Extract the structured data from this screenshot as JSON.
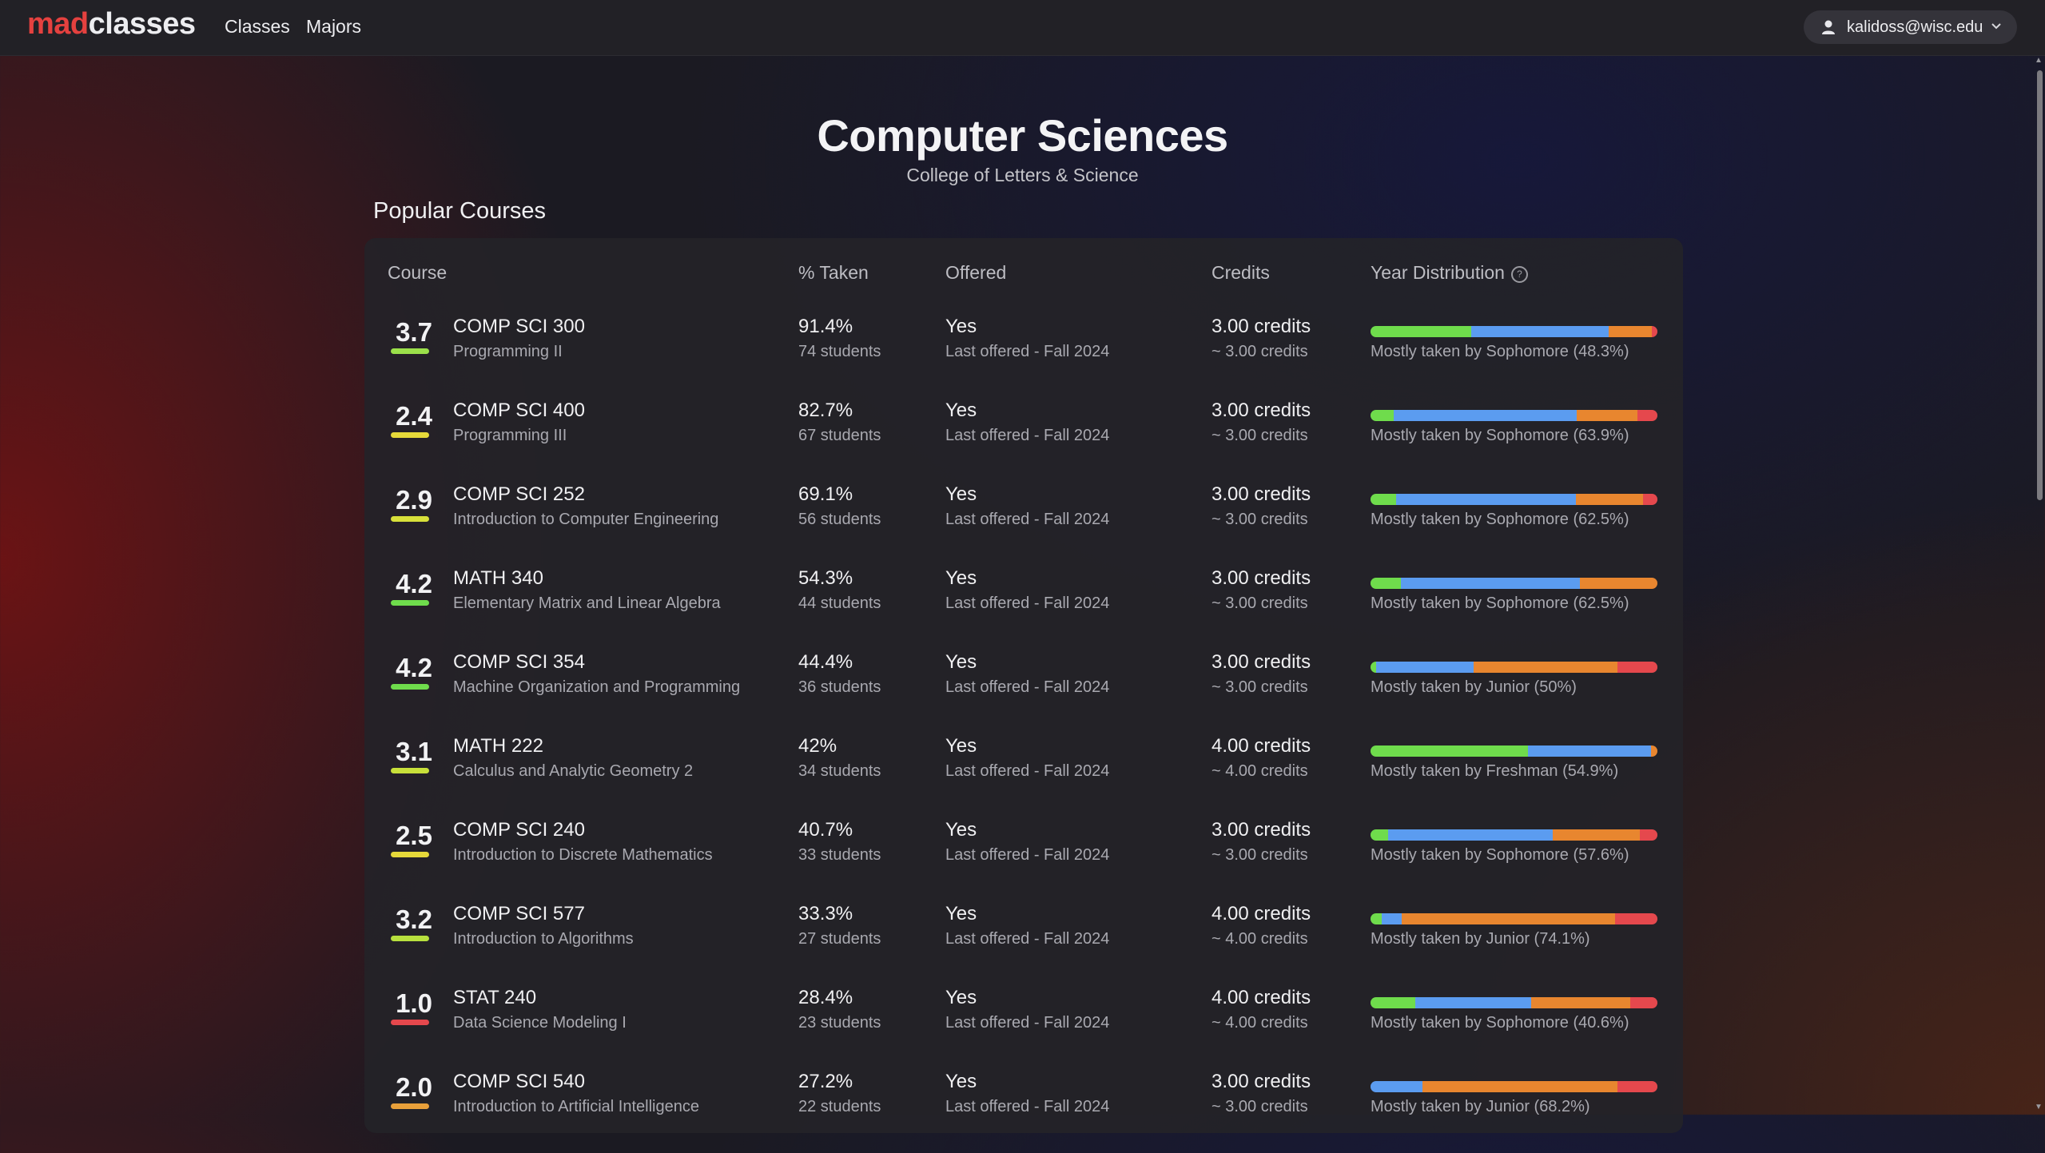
{
  "nav": {
    "logo_part1": "mad",
    "logo_part2": "classes",
    "links": [
      "Classes",
      "Majors"
    ],
    "user_email": "kalidoss@wisc.edu"
  },
  "page": {
    "title": "Computer Sciences",
    "subtitle": "College of Letters & Science",
    "section_title": "Popular Courses"
  },
  "table": {
    "headers": {
      "course": "Course",
      "taken": "% Taken",
      "offered": "Offered",
      "credits": "Credits",
      "distribution": "Year Distribution"
    },
    "colors": {
      "freshman": "#6fdc4c",
      "sophomore": "#5b9cf0",
      "junior": "#e8862f",
      "senior": "#e5484d"
    },
    "rows": [
      {
        "gpa": "3.7",
        "gpa_color": "#9be04a",
        "code": "COMP SCI 300",
        "name": "Programming II",
        "pct": "91.4%",
        "students": "74 students",
        "offered": "Yes",
        "last": "Last offered - Fall 2024",
        "credits": "3.00 credits",
        "credits_approx": "~ 3.00 credits",
        "dist": [
          0.35,
          0.48,
          0.15,
          0.02
        ],
        "mostly": "Mostly taken by Sophomore (48.3%)"
      },
      {
        "gpa": "2.4",
        "gpa_color": "#e6d93a",
        "code": "COMP SCI 400",
        "name": "Programming III",
        "pct": "82.7%",
        "students": "67 students",
        "offered": "Yes",
        "last": "Last offered - Fall 2024",
        "credits": "3.00 credits",
        "credits_approx": "~ 3.00 credits",
        "dist": [
          0.08,
          0.64,
          0.21,
          0.07
        ],
        "mostly": "Mostly taken by Sophomore (63.9%)"
      },
      {
        "gpa": "2.9",
        "gpa_color": "#d8e03a",
        "code": "COMP SCI 252",
        "name": "Introduction to Computer Engineering",
        "pct": "69.1%",
        "students": "56 students",
        "offered": "Yes",
        "last": "Last offered - Fall 2024",
        "credits": "3.00 credits",
        "credits_approx": "~ 3.00 credits",
        "dist": [
          0.09,
          0.625,
          0.235,
          0.05
        ],
        "mostly": "Mostly taken by Sophomore (62.5%)"
      },
      {
        "gpa": "4.2",
        "gpa_color": "#6fdc4c",
        "code": "MATH 340",
        "name": "Elementary Matrix and Linear Algebra",
        "pct": "54.3%",
        "students": "44 students",
        "offered": "Yes",
        "last": "Last offered - Fall 2024",
        "credits": "3.00 credits",
        "credits_approx": "~ 3.00 credits",
        "dist": [
          0.105,
          0.625,
          0.27,
          0.0
        ],
        "mostly": "Mostly taken by Sophomore (62.5%)"
      },
      {
        "gpa": "4.2",
        "gpa_color": "#6fdc4c",
        "code": "COMP SCI 354",
        "name": "Machine Organization and Programming",
        "pct": "44.4%",
        "students": "36 students",
        "offered": "Yes",
        "last": "Last offered - Fall 2024",
        "credits": "3.00 credits",
        "credits_approx": "~ 3.00 credits",
        "dist": [
          0.02,
          0.34,
          0.5,
          0.14
        ],
        "mostly": "Mostly taken by Junior (50%)"
      },
      {
        "gpa": "3.1",
        "gpa_color": "#c8e03a",
        "code": "MATH 222",
        "name": "Calculus and Analytic Geometry 2",
        "pct": "42%",
        "students": "34 students",
        "offered": "Yes",
        "last": "Last offered - Fall 2024",
        "credits": "4.00 credits",
        "credits_approx": "~ 4.00 credits",
        "dist": [
          0.549,
          0.43,
          0.021,
          0.0
        ],
        "mostly": "Mostly taken by Freshman (54.9%)"
      },
      {
        "gpa": "2.5",
        "gpa_color": "#e6d93a",
        "code": "COMP SCI 240",
        "name": "Introduction to Discrete Mathematics",
        "pct": "40.7%",
        "students": "33 students",
        "offered": "Yes",
        "last": "Last offered - Fall 2024",
        "credits": "3.00 credits",
        "credits_approx": "~ 3.00 credits",
        "dist": [
          0.06,
          0.576,
          0.304,
          0.06
        ],
        "mostly": "Mostly taken by Sophomore (57.6%)"
      },
      {
        "gpa": "3.2",
        "gpa_color": "#b8e03e",
        "code": "COMP SCI 577",
        "name": "Introduction to Algorithms",
        "pct": "33.3%",
        "students": "27 students",
        "offered": "Yes",
        "last": "Last offered - Fall 2024",
        "credits": "4.00 credits",
        "credits_approx": "~ 4.00 credits",
        "dist": [
          0.04,
          0.07,
          0.741,
          0.149
        ],
        "mostly": "Mostly taken by Junior (74.1%)"
      },
      {
        "gpa": "1.0",
        "gpa_color": "#e5484d",
        "code": "STAT 240",
        "name": "Data Science Modeling I",
        "pct": "28.4%",
        "students": "23 students",
        "offered": "Yes",
        "last": "Last offered - Fall 2024",
        "credits": "4.00 credits",
        "credits_approx": "~ 4.00 credits",
        "dist": [
          0.155,
          0.406,
          0.344,
          0.095
        ],
        "mostly": "Mostly taken by Sophomore (40.6%)"
      },
      {
        "gpa": "2.0",
        "gpa_color": "#e8a03a",
        "code": "COMP SCI 540",
        "name": "Introduction to Artificial Intelligence",
        "pct": "27.2%",
        "students": "22 students",
        "offered": "Yes",
        "last": "Last offered - Fall 2024",
        "credits": "3.00 credits",
        "credits_approx": "~ 3.00 credits",
        "dist": [
          0.0,
          0.18,
          0.682,
          0.138
        ],
        "mostly": "Mostly taken by Junior (68.2%)"
      }
    ]
  }
}
